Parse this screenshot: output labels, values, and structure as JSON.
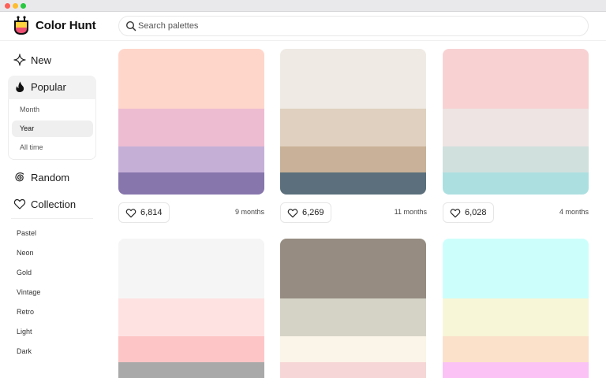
{
  "window": {
    "controls": [
      "close",
      "minimize",
      "zoom"
    ]
  },
  "header": {
    "brand": "Color Hunt",
    "logo_icon": "color-hunt-logo-icon",
    "search_placeholder": "Search palettes"
  },
  "sidebar": {
    "new": {
      "label": "New",
      "icon": "sparkle-icon"
    },
    "popular": {
      "label": "Popular",
      "icon": "flame-icon",
      "sub": {
        "month": "Month",
        "year": "Year",
        "all_time": "All time"
      },
      "selected": "Year"
    },
    "random": {
      "label": "Random",
      "icon": "spiral-icon"
    },
    "collection": {
      "label": "Collection",
      "icon": "heart-icon"
    },
    "tags": [
      "Pastel",
      "Neon",
      "Gold",
      "Vintage",
      "Retro",
      "Light",
      "Dark"
    ]
  },
  "palettes": [
    {
      "colors": [
        "#FFD6CA",
        "#EDBCD1",
        "#C5AFD7",
        "#8676AC"
      ],
      "likes": "6,814",
      "age": "9 months"
    },
    {
      "colors": [
        "#EFEAE4",
        "#DFD0BF",
        "#C8B198",
        "#5B707C"
      ],
      "likes": "6,269",
      "age": "11 months"
    },
    {
      "colors": [
        "#F8D2D3",
        "#EDE4E3",
        "#D0E0DD",
        "#ACE0E0"
      ],
      "likes": "6,028",
      "age": "4 months"
    },
    {
      "colors": [
        "#F5F5F5",
        "#FEE2E2",
        "#FDC5C5",
        "#A9A9A9"
      ]
    },
    {
      "colors": [
        "#968C81",
        "#D5D3C6",
        "#FBF4E8",
        "#F6D6D6"
      ]
    },
    {
      "colors": [
        "#CCFFFC",
        "#F7F6D7",
        "#FBE1C9",
        "#FBC2F6"
      ]
    }
  ]
}
